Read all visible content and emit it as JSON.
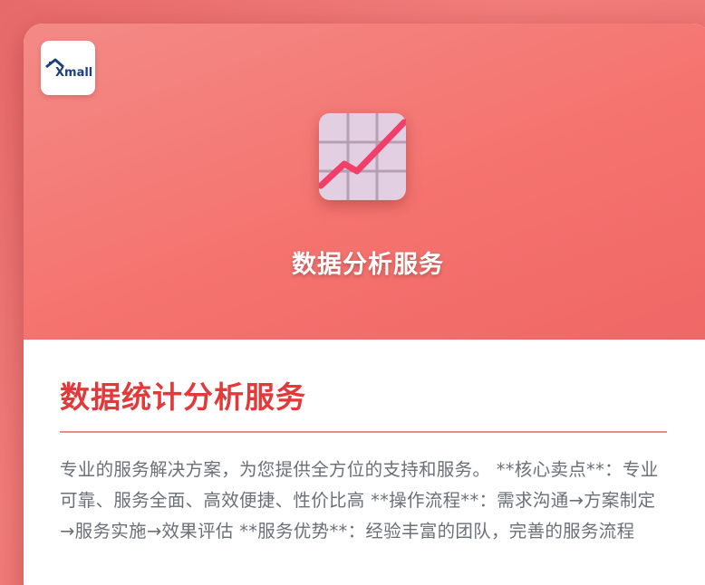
{
  "brand": {
    "logo_text": "Xmall"
  },
  "hero": {
    "title": "数据分析服务",
    "icon": "line-chart-grid-icon"
  },
  "section": {
    "title": "数据统计分析服务",
    "description": "专业的服务解决方案，为您提供全方位的支持和服务。 **核心卖点**：专业可靠、服务全面、高效便捷、性价比高 **操作流程**：需求沟通→方案制定→服务实施→效果评估 **服务优势**：经验丰富的团队，完善的服务流程"
  },
  "colors": {
    "accent": "#e23a3a",
    "hero_gradient_start": "#f38a86",
    "hero_gradient_end": "#ef6766",
    "text_gray": "#6b6f76",
    "chart_line": "#f0406a",
    "chart_tile": "#e3cfe2"
  }
}
